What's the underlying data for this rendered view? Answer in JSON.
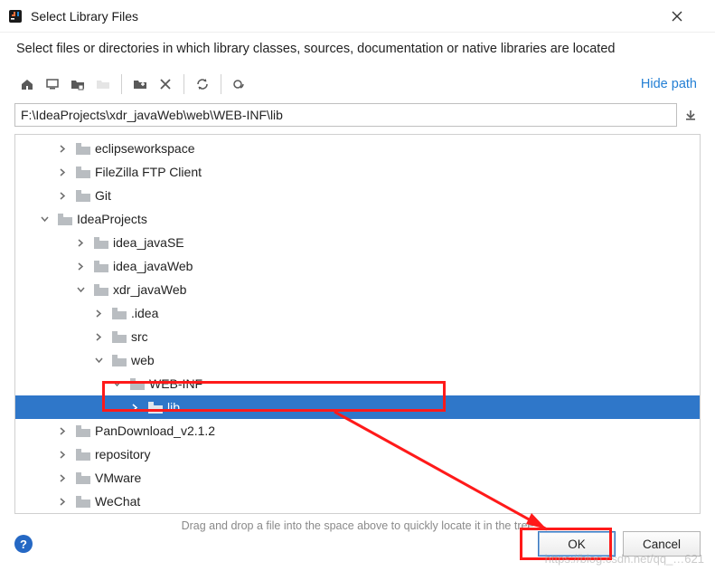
{
  "window": {
    "title": "Select Library Files",
    "subtitle": "Select files or directories in which library classes, sources, documentation or native libraries are located"
  },
  "toolbar": {
    "hide_path_label": "Hide path"
  },
  "path": {
    "value": "F:\\IdeaProjects\\xdr_javaWeb\\web\\WEB-INF\\lib"
  },
  "tree": [
    {
      "label": "eclipseworkspace",
      "indent": 2,
      "expanded": false,
      "selected": false
    },
    {
      "label": "FileZilla FTP Client",
      "indent": 2,
      "expanded": false,
      "selected": false
    },
    {
      "label": "Git",
      "indent": 2,
      "expanded": false,
      "selected": false
    },
    {
      "label": "IdeaProjects",
      "indent": 1,
      "expanded": true,
      "selected": false
    },
    {
      "label": "idea_javaSE",
      "indent": 3,
      "expanded": false,
      "selected": false
    },
    {
      "label": "idea_javaWeb",
      "indent": 3,
      "expanded": false,
      "selected": false
    },
    {
      "label": "xdr_javaWeb",
      "indent": 3,
      "expanded": true,
      "selected": false
    },
    {
      "label": ".idea",
      "indent": 4,
      "expanded": false,
      "selected": false
    },
    {
      "label": "src",
      "indent": 4,
      "expanded": false,
      "selected": false
    },
    {
      "label": "web",
      "indent": 4,
      "expanded": true,
      "selected": false
    },
    {
      "label": "WEB-INF",
      "indent": 5,
      "expanded": true,
      "selected": false
    },
    {
      "label": "lib",
      "indent": 6,
      "expanded": false,
      "selected": true
    },
    {
      "label": "PanDownload_v2.1.2",
      "indent": 2,
      "expanded": false,
      "selected": false
    },
    {
      "label": "repository",
      "indent": 2,
      "expanded": false,
      "selected": false
    },
    {
      "label": "VMware",
      "indent": 2,
      "expanded": false,
      "selected": false
    },
    {
      "label": "WeChat",
      "indent": 2,
      "expanded": false,
      "selected": false
    }
  ],
  "hint": "Drag and drop a file into the space above to quickly locate it in the tree",
  "footer": {
    "ok_label": "OK",
    "cancel_label": "Cancel"
  },
  "colors": {
    "link": "#237fd4",
    "selection": "#2f77c9",
    "annotation": "#ff1a1a",
    "folder": "#b9bdc1",
    "folder_dark": "#8f949a"
  },
  "watermark": "https://blog.csdn.net/qq_…621"
}
